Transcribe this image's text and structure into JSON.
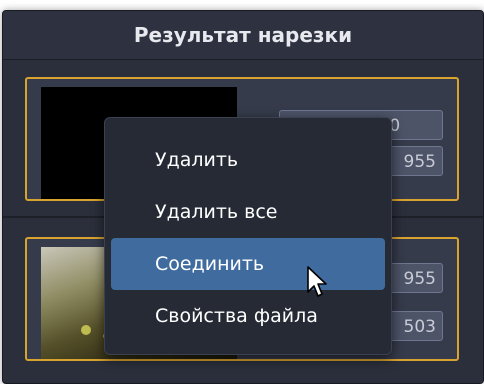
{
  "panel": {
    "title": "Результат нарезки"
  },
  "clips": [
    {
      "start_time": "00:00:00.000",
      "end_time": "955",
      "thumbnail": "black"
    },
    {
      "start_time": "955",
      "end_time": "503",
      "thumbnail": "landscape"
    }
  ],
  "context_menu": {
    "items": [
      {
        "label": "Удалить"
      },
      {
        "label": "Удалить все"
      },
      {
        "label": "Соединить",
        "selected": true
      },
      {
        "label": "Свойства файла"
      }
    ]
  },
  "colors": {
    "accent_border": "#d9a32f",
    "selected_item": "#3f6b9e",
    "panel_bg": "#2b2f3b"
  }
}
